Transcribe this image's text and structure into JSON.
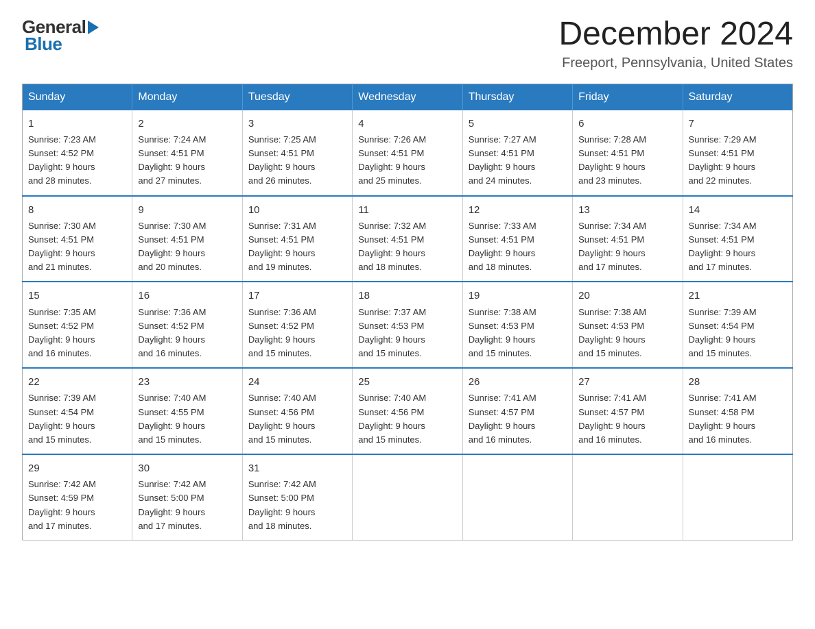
{
  "header": {
    "logo": {
      "general": "General",
      "blue": "Blue"
    },
    "title": "December 2024",
    "location": "Freeport, Pennsylvania, United States"
  },
  "days_of_week": [
    "Sunday",
    "Monday",
    "Tuesday",
    "Wednesday",
    "Thursday",
    "Friday",
    "Saturday"
  ],
  "weeks": [
    [
      {
        "date": "1",
        "sunrise": "7:23 AM",
        "sunset": "4:52 PM",
        "daylight": "9 hours and 28 minutes."
      },
      {
        "date": "2",
        "sunrise": "7:24 AM",
        "sunset": "4:51 PM",
        "daylight": "9 hours and 27 minutes."
      },
      {
        "date": "3",
        "sunrise": "7:25 AM",
        "sunset": "4:51 PM",
        "daylight": "9 hours and 26 minutes."
      },
      {
        "date": "4",
        "sunrise": "7:26 AM",
        "sunset": "4:51 PM",
        "daylight": "9 hours and 25 minutes."
      },
      {
        "date": "5",
        "sunrise": "7:27 AM",
        "sunset": "4:51 PM",
        "daylight": "9 hours and 24 minutes."
      },
      {
        "date": "6",
        "sunrise": "7:28 AM",
        "sunset": "4:51 PM",
        "daylight": "9 hours and 23 minutes."
      },
      {
        "date": "7",
        "sunrise": "7:29 AM",
        "sunset": "4:51 PM",
        "daylight": "9 hours and 22 minutes."
      }
    ],
    [
      {
        "date": "8",
        "sunrise": "7:30 AM",
        "sunset": "4:51 PM",
        "daylight": "9 hours and 21 minutes."
      },
      {
        "date": "9",
        "sunrise": "7:30 AM",
        "sunset": "4:51 PM",
        "daylight": "9 hours and 20 minutes."
      },
      {
        "date": "10",
        "sunrise": "7:31 AM",
        "sunset": "4:51 PM",
        "daylight": "9 hours and 19 minutes."
      },
      {
        "date": "11",
        "sunrise": "7:32 AM",
        "sunset": "4:51 PM",
        "daylight": "9 hours and 18 minutes."
      },
      {
        "date": "12",
        "sunrise": "7:33 AM",
        "sunset": "4:51 PM",
        "daylight": "9 hours and 18 minutes."
      },
      {
        "date": "13",
        "sunrise": "7:34 AM",
        "sunset": "4:51 PM",
        "daylight": "9 hours and 17 minutes."
      },
      {
        "date": "14",
        "sunrise": "7:34 AM",
        "sunset": "4:51 PM",
        "daylight": "9 hours and 17 minutes."
      }
    ],
    [
      {
        "date": "15",
        "sunrise": "7:35 AM",
        "sunset": "4:52 PM",
        "daylight": "9 hours and 16 minutes."
      },
      {
        "date": "16",
        "sunrise": "7:36 AM",
        "sunset": "4:52 PM",
        "daylight": "9 hours and 16 minutes."
      },
      {
        "date": "17",
        "sunrise": "7:36 AM",
        "sunset": "4:52 PM",
        "daylight": "9 hours and 15 minutes."
      },
      {
        "date": "18",
        "sunrise": "7:37 AM",
        "sunset": "4:53 PM",
        "daylight": "9 hours and 15 minutes."
      },
      {
        "date": "19",
        "sunrise": "7:38 AM",
        "sunset": "4:53 PM",
        "daylight": "9 hours and 15 minutes."
      },
      {
        "date": "20",
        "sunrise": "7:38 AM",
        "sunset": "4:53 PM",
        "daylight": "9 hours and 15 minutes."
      },
      {
        "date": "21",
        "sunrise": "7:39 AM",
        "sunset": "4:54 PM",
        "daylight": "9 hours and 15 minutes."
      }
    ],
    [
      {
        "date": "22",
        "sunrise": "7:39 AM",
        "sunset": "4:54 PM",
        "daylight": "9 hours and 15 minutes."
      },
      {
        "date": "23",
        "sunrise": "7:40 AM",
        "sunset": "4:55 PM",
        "daylight": "9 hours and 15 minutes."
      },
      {
        "date": "24",
        "sunrise": "7:40 AM",
        "sunset": "4:56 PM",
        "daylight": "9 hours and 15 minutes."
      },
      {
        "date": "25",
        "sunrise": "7:40 AM",
        "sunset": "4:56 PM",
        "daylight": "9 hours and 15 minutes."
      },
      {
        "date": "26",
        "sunrise": "7:41 AM",
        "sunset": "4:57 PM",
        "daylight": "9 hours and 16 minutes."
      },
      {
        "date": "27",
        "sunrise": "7:41 AM",
        "sunset": "4:57 PM",
        "daylight": "9 hours and 16 minutes."
      },
      {
        "date": "28",
        "sunrise": "7:41 AM",
        "sunset": "4:58 PM",
        "daylight": "9 hours and 16 minutes."
      }
    ],
    [
      {
        "date": "29",
        "sunrise": "7:42 AM",
        "sunset": "4:59 PM",
        "daylight": "9 hours and 17 minutes."
      },
      {
        "date": "30",
        "sunrise": "7:42 AM",
        "sunset": "5:00 PM",
        "daylight": "9 hours and 17 minutes."
      },
      {
        "date": "31",
        "sunrise": "7:42 AM",
        "sunset": "5:00 PM",
        "daylight": "9 hours and 18 minutes."
      },
      null,
      null,
      null,
      null
    ]
  ],
  "labels": {
    "sunrise": "Sunrise:",
    "sunset": "Sunset:",
    "daylight": "Daylight:"
  }
}
